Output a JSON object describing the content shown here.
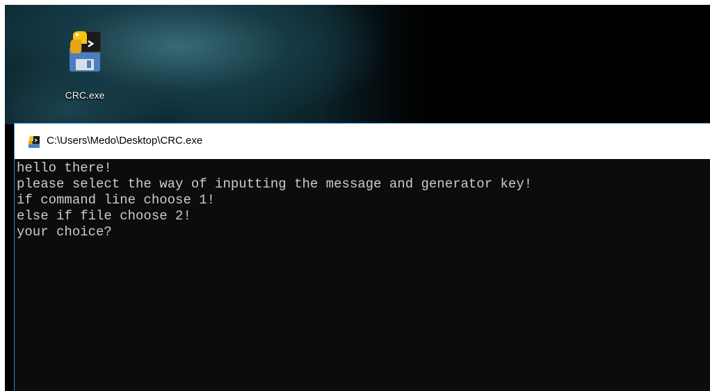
{
  "desktop": {
    "icons": [
      {
        "label": "CRC.exe",
        "icon": "python-exe-icon"
      }
    ]
  },
  "console": {
    "title": "C:\\Users\\Medo\\Desktop\\CRC.exe",
    "title_icon": "python-exe-icon",
    "background": "#0c0c0c",
    "text_color": "#cccccc",
    "lines": [
      "hello there!",
      "please select the way of inputting the message and generator key!",
      "if command line choose 1!",
      "else if file choose 2!",
      "your choice?"
    ]
  }
}
